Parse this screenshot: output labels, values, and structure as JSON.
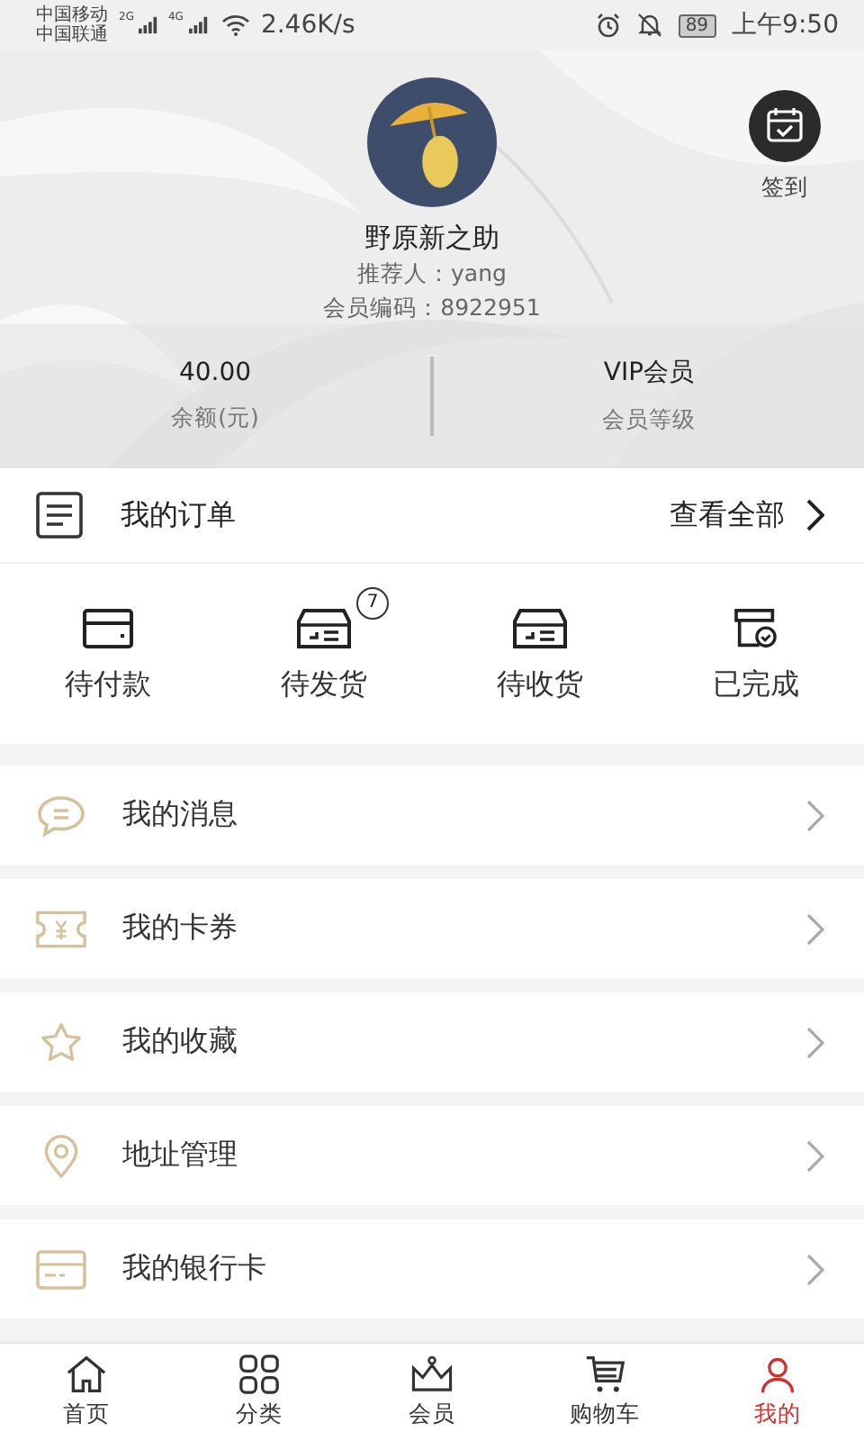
{
  "status_bar": {
    "carrier_1": "中国移动",
    "carrier_2": "中国联通",
    "net_1": "2G",
    "net_2": "4G",
    "speed": "2.46K/s",
    "battery": "89",
    "time": "上午9:50"
  },
  "profile": {
    "name": "野原新之助",
    "referrer": "推荐人：yang",
    "member_code": "会员编码：8922951",
    "checkin": "签到"
  },
  "stats": [
    {
      "value": "40.00",
      "label": "余额(元)"
    },
    {
      "value": "VIP会员",
      "label": "会员等级"
    }
  ],
  "orders": {
    "title": "我的订单",
    "view_all": "查看全部",
    "statuses": [
      {
        "kind": "pay",
        "label": "待付款"
      },
      {
        "kind": "ship",
        "label": "待发货",
        "badge": "7"
      },
      {
        "kind": "receive",
        "label": "待收货"
      },
      {
        "kind": "done",
        "label": "已完成"
      }
    ]
  },
  "menu": [
    {
      "kind": "message",
      "label": "我的消息"
    },
    {
      "kind": "coupon",
      "label": "我的卡券"
    },
    {
      "kind": "favorite",
      "label": "我的收藏"
    },
    {
      "kind": "address",
      "label": "地址管理"
    },
    {
      "kind": "bankcard",
      "label": "我的银行卡"
    }
  ],
  "tabs": [
    {
      "kind": "home",
      "label": "首页",
      "selected": false
    },
    {
      "kind": "category",
      "label": "分类",
      "selected": false
    },
    {
      "kind": "member",
      "label": "会员",
      "selected": false
    },
    {
      "kind": "cart",
      "label": "购物车",
      "selected": false
    },
    {
      "kind": "mine",
      "label": "我的",
      "selected": true
    }
  ]
}
